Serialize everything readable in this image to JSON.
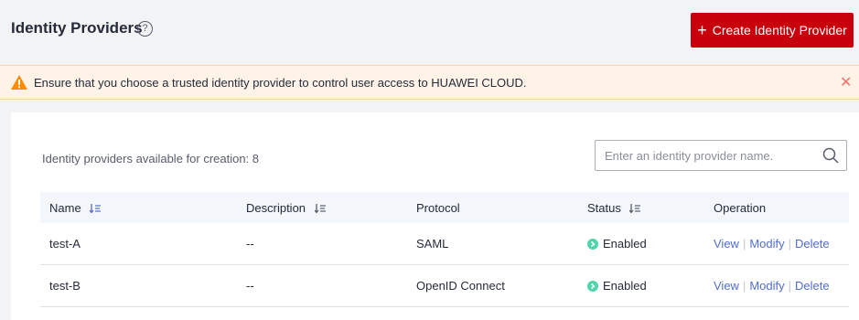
{
  "header": {
    "title": "Identity Providers",
    "create_button": "Create Identity Provider"
  },
  "alert": {
    "message": "Ensure that you choose a trusted identity provider to control user access to HUAWEI CLOUD."
  },
  "main": {
    "available_text": "Identity providers available for creation: 8",
    "search_placeholder": "Enter an identity provider name.",
    "columns": [
      "Name",
      "Description",
      "Protocol",
      "Status",
      "Operation"
    ],
    "rows": [
      {
        "name": "test-A",
        "description": "--",
        "protocol": "SAML",
        "status": "Enabled",
        "actions": [
          "View",
          "Modify",
          "Delete"
        ]
      },
      {
        "name": "test-B",
        "description": "--",
        "protocol": "OpenID Connect",
        "status": "Enabled",
        "actions": [
          "View",
          "Modify",
          "Delete"
        ]
      }
    ]
  },
  "colors": {
    "brand": "#c7000b",
    "link": "#526ecc",
    "enabled": "#50d4ab",
    "warning": "#ff8c00"
  },
  "icons": [
    "help-icon",
    "plus-icon",
    "warning-icon",
    "close-icon",
    "search-icon",
    "sort-icon",
    "status-enabled-icon"
  ]
}
